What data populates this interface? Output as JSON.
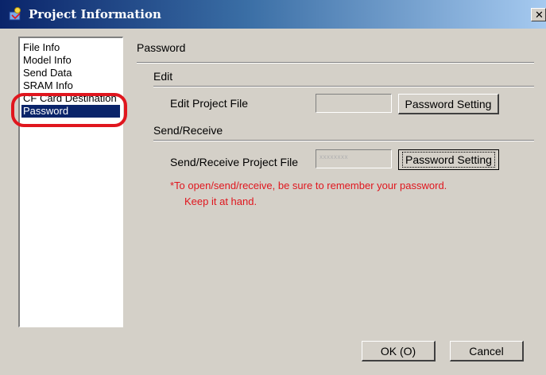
{
  "window": {
    "title": "Project Information",
    "close_glyph": "✕"
  },
  "sidebar": {
    "items": [
      {
        "label": "File Info",
        "selected": false
      },
      {
        "label": "Model Info",
        "selected": false
      },
      {
        "label": "Send Data",
        "selected": false
      },
      {
        "label": "SRAM Info",
        "selected": false
      },
      {
        "label": "CF Card Destination",
        "selected": false
      },
      {
        "label": "Password",
        "selected": true
      }
    ]
  },
  "main": {
    "header": "Password",
    "edit": {
      "section_label": "Edit",
      "field_label": "Edit Project File",
      "field_value": "",
      "button_label": "Password Setting"
    },
    "send_receive": {
      "section_label": "Send/Receive",
      "field_label": "Send/Receive Project File",
      "field_value": "xxxxxxxx",
      "button_label": "Password Setting"
    },
    "note_line1": "*To open/send/receive, be sure to remember your password.",
    "note_line2": "Keep it at hand."
  },
  "footer": {
    "ok_label": "OK (O)",
    "cancel_label": "Cancel"
  },
  "colors": {
    "accent": "#e0161e",
    "selection": "#0a246a",
    "dialog_bg": "#d4d0c8"
  },
  "icons": [
    "project-info-icon",
    "close-icon"
  ]
}
